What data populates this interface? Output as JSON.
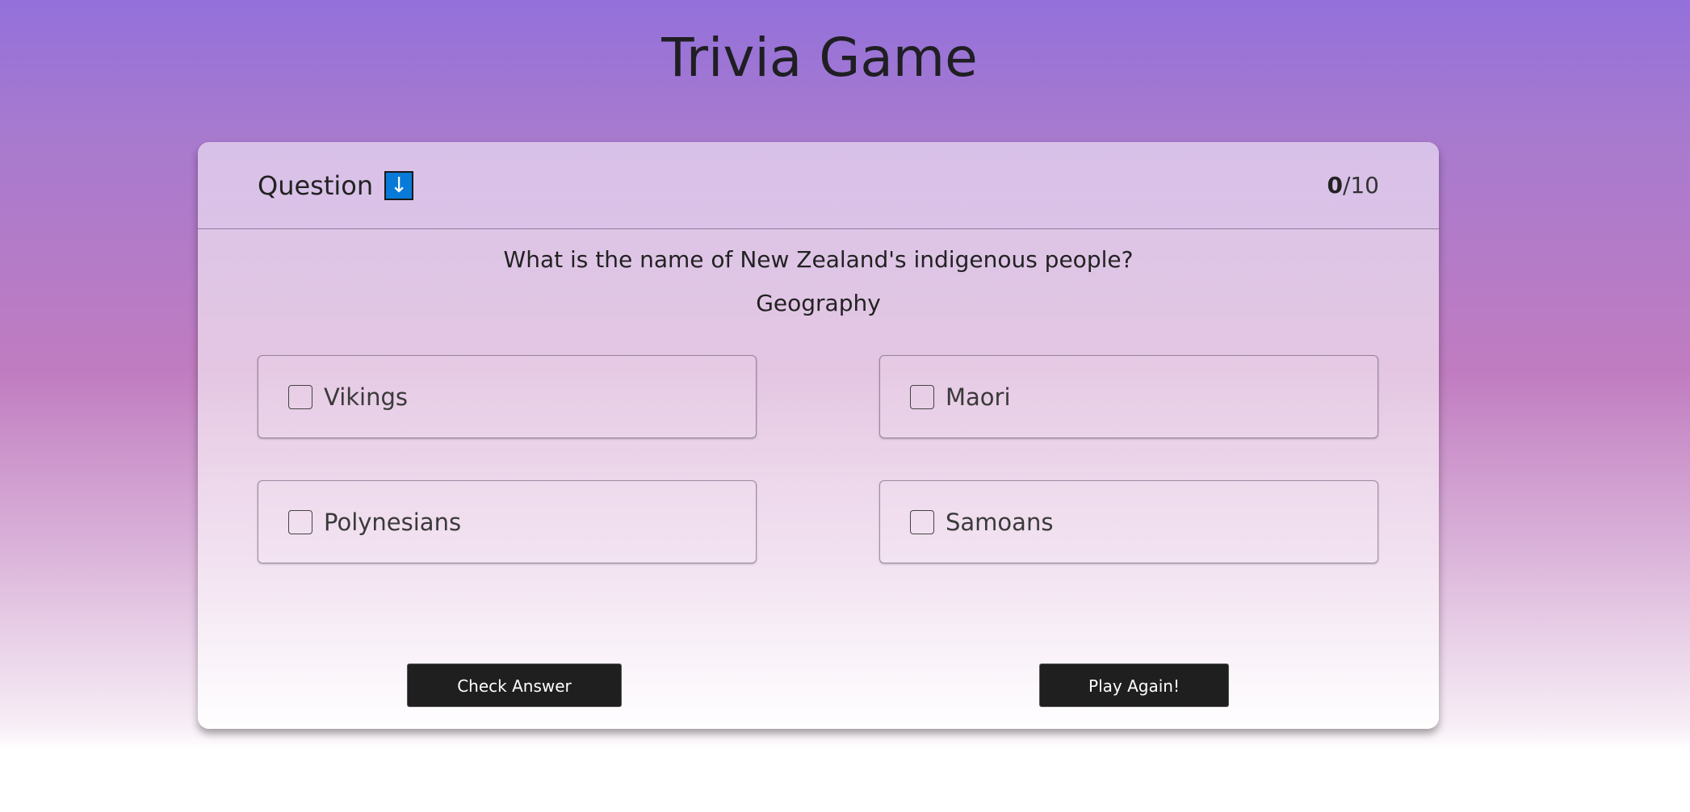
{
  "page": {
    "title": "Trivia Game"
  },
  "header": {
    "question_label": "Question",
    "question_icon": "down-arrow-icon",
    "score_correct": "0",
    "score_total": "/10"
  },
  "question": {
    "text": "What is the name of New Zealand's indigenous people?",
    "category": "Geography"
  },
  "options": [
    {
      "label": "Vikings",
      "checked": false
    },
    {
      "label": "Maori",
      "checked": false
    },
    {
      "label": "Polynesians",
      "checked": false
    },
    {
      "label": "Samoans",
      "checked": false
    }
  ],
  "buttons": {
    "check_label": "Check Answer",
    "play_again_label": "Play Again!"
  },
  "colors": {
    "background_top": "#9370db",
    "background_mid": "#c07cc0",
    "icon_blue": "#0a7ad8",
    "button_dark": "#1f1f1f"
  }
}
